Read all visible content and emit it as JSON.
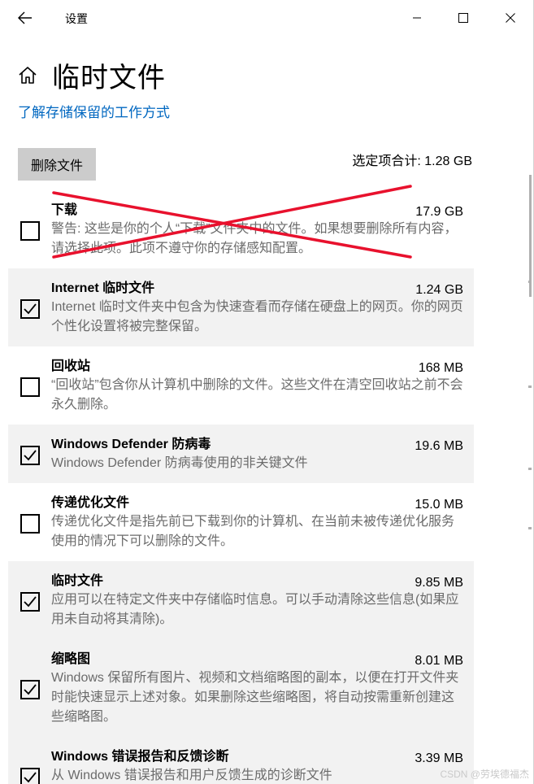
{
  "window": {
    "title": "设置"
  },
  "page": {
    "title": "临时文件",
    "link": "了解存储保留的工作方式"
  },
  "toolbar": {
    "delete_label": "删除文件",
    "total_label": "选定项合计: 1.28 GB"
  },
  "items": [
    {
      "name": "下载",
      "size": "17.9 GB",
      "checked": false,
      "shaded": false,
      "desc": "警告: 这些是你的个人“下载”文件夹中的文件。如果想要删除所有内容，请选择此项。此项不遵守你的存储感知配置。"
    },
    {
      "name": "Internet 临时文件",
      "size": "1.24 GB",
      "checked": true,
      "shaded": true,
      "desc": "Internet 临时文件夹中包含为快速查看而存储在硬盘上的网页。你的网页个性化设置将被完整保留。"
    },
    {
      "name": "回收站",
      "size": "168 MB",
      "checked": false,
      "shaded": false,
      "desc": "“回收站”包含你从计算机中删除的文件。这些文件在清空回收站之前不会永久删除。"
    },
    {
      "name": "Windows Defender 防病毒",
      "size": "19.6 MB",
      "checked": true,
      "shaded": true,
      "desc": "Windows Defender 防病毒使用的非关键文件"
    },
    {
      "name": "传递优化文件",
      "size": "15.0 MB",
      "checked": false,
      "shaded": false,
      "desc": "传递优化文件是指先前已下载到你的计算机、在当前未被传递优化服务使用的情况下可以删除的文件。"
    },
    {
      "name": "临时文件",
      "size": "9.85 MB",
      "checked": true,
      "shaded": true,
      "desc": "应用可以在特定文件夹中存储临时信息。可以手动清除这些信息(如果应用未自动将其清除)。"
    },
    {
      "name": "缩略图",
      "size": "8.01 MB",
      "checked": true,
      "shaded": true,
      "desc": "Windows 保留所有图片、视频和文档缩略图的副本，以便在打开文件夹时能快速显示上述对象。如果删除这些缩略图，将自动按需重新创建这些缩略图。"
    },
    {
      "name": "Windows 错误报告和反馈诊断",
      "size": "3.39 MB",
      "checked": true,
      "shaded": true,
      "desc": "从 Windows 错误报告和用户反馈生成的诊断文件"
    }
  ],
  "watermark": "CSDN @劳埃德福杰",
  "colors": {
    "link": "#0067c0",
    "annotation_cross": "#e8112d",
    "shaded_row": "#f2f2f2",
    "button_bg": "#cccccc"
  }
}
